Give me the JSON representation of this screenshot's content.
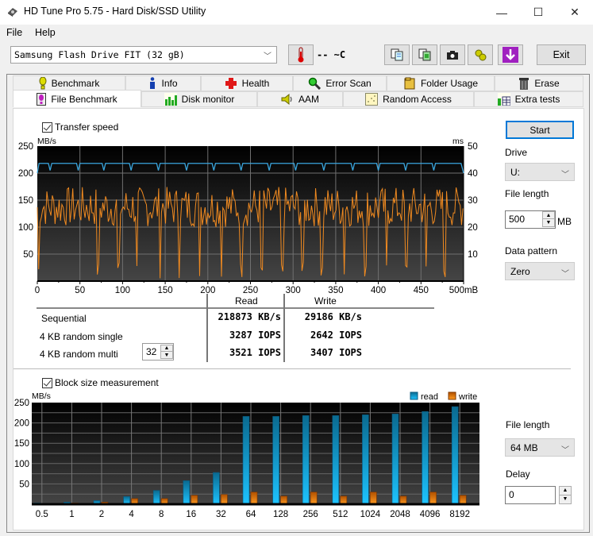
{
  "window": {
    "title": "HD Tune Pro 5.75 - Hard Disk/SSD Utility",
    "icons": {
      "app": "hdd-icon",
      "minimize": "minimize-icon",
      "maximize": "maximize-icon",
      "close": "close-icon"
    },
    "min_glyph": "—",
    "max_glyph": "☐",
    "close_glyph": "✕"
  },
  "menu": {
    "file": "File",
    "help": "Help"
  },
  "toolbar": {
    "drive": "Samsung Flash Drive FIT (32 gB)",
    "temperature": "-- ~C",
    "buttons": [
      "copy-info-icon",
      "copy-all-icon",
      "screenshot-icon",
      "options-icon",
      "save-icon"
    ],
    "exit": "Exit"
  },
  "tabs": {
    "row1": [
      {
        "label": "Benchmark",
        "icon": "benchmark-icon"
      },
      {
        "label": "Info",
        "icon": "info-icon"
      },
      {
        "label": "Health",
        "icon": "health-icon"
      },
      {
        "label": "Error Scan",
        "icon": "error-scan-icon"
      },
      {
        "label": "Folder Usage",
        "icon": "folder-icon"
      },
      {
        "label": "Erase",
        "icon": "trash-icon"
      }
    ],
    "row2": [
      {
        "label": "File Benchmark",
        "icon": "file-benchmark-icon",
        "active": true
      },
      {
        "label": "Disk monitor",
        "icon": "disk-monitor-icon"
      },
      {
        "label": "AAM",
        "icon": "speaker-icon"
      },
      {
        "label": "Random Access",
        "icon": "random-access-icon"
      },
      {
        "label": "Extra tests",
        "icon": "extra-tests-icon"
      }
    ]
  },
  "transfer": {
    "checkbox_label": "Transfer speed",
    "checked": true,
    "y_unit": "MB/s",
    "y2_unit": "ms",
    "x_unit_suffix": "mB"
  },
  "results": {
    "col_read": "Read",
    "col_write": "Write",
    "rows": [
      {
        "label": "Sequential",
        "read": "218873 KB/s",
        "write": "29186 KB/s"
      },
      {
        "label": "4 KB random single",
        "read": "3287 IOPS",
        "write": "2642 IOPS"
      },
      {
        "label": "4 KB random multi",
        "read": "3521 IOPS",
        "write": "3407 IOPS"
      }
    ],
    "queue_depth": "32"
  },
  "side": {
    "start": "Start",
    "drive_label": "Drive",
    "drive_value": "U:",
    "file_length_label": "File length",
    "file_length_value": "500",
    "file_length_unit": "MB",
    "data_pattern_label": "Data pattern",
    "data_pattern_value": "Zero"
  },
  "block": {
    "checkbox_label": "Block size measurement",
    "checked": true,
    "file_length_label": "File length",
    "file_length_value": "64 MB",
    "delay_label": "Delay",
    "delay_value": "0"
  },
  "colors": {
    "read": "#29a8e0",
    "write": "#e07a10",
    "read_line": "#3aa6de",
    "write_line": "#f08a20"
  },
  "chart_data": [
    {
      "type": "line",
      "title": "Transfer speed",
      "xlabel": "mB",
      "ylabel": "MB/s",
      "y2label": "ms",
      "xlim": [
        0,
        500
      ],
      "ylim": [
        0,
        250
      ],
      "y2lim": [
        0,
        50
      ],
      "xticks": [
        0,
        50,
        100,
        150,
        200,
        250,
        300,
        350,
        400,
        450,
        500
      ],
      "xtick_labels": [
        "0",
        "50",
        "100",
        "150",
        "200",
        "250",
        "300",
        "350",
        "400",
        "450",
        "500mB"
      ],
      "yticks": [
        50,
        100,
        150,
        200,
        250
      ],
      "y2ticks": [
        10,
        20,
        30,
        40,
        50
      ],
      "grid": true,
      "series": [
        {
          "name": "read",
          "axis": "left",
          "baseline": 218,
          "dips_at": [
            15,
            48,
            78,
            110,
            142,
            175,
            207,
            239,
            272,
            303,
            336,
            370,
            400,
            432,
            465
          ],
          "dip_value": 205,
          "end_value": 200
        },
        {
          "name": "write",
          "axis": "left",
          "typical_range": [
            100,
            175
          ],
          "dips_at": [
            2,
            71,
            95,
            117,
            144,
            166,
            190,
            216,
            239,
            263,
            287,
            311,
            334,
            360,
            385,
            410,
            433,
            456,
            478
          ],
          "dip_value": 5
        }
      ]
    },
    {
      "type": "bar",
      "title": "Block size measurement",
      "ylabel": "MB/s",
      "ylim": [
        0,
        250
      ],
      "yticks": [
        50,
        100,
        150,
        200,
        250
      ],
      "grid": true,
      "legend": "top-right",
      "categories": [
        "0.5",
        "1",
        "2",
        "4",
        "8",
        "16",
        "32",
        "64",
        "128",
        "256",
        "512",
        "1024",
        "2048",
        "4096",
        "8192"
      ],
      "series": [
        {
          "name": "read",
          "values": [
            3,
            5,
            9,
            19,
            34,
            58,
            78,
            216,
            216,
            218,
            218,
            220,
            222,
            228,
            240
          ]
        },
        {
          "name": "write",
          "values": [
            1,
            3,
            5,
            14,
            14,
            22,
            24,
            30,
            20,
            30,
            20,
            30,
            20,
            30,
            22
          ]
        }
      ]
    }
  ]
}
